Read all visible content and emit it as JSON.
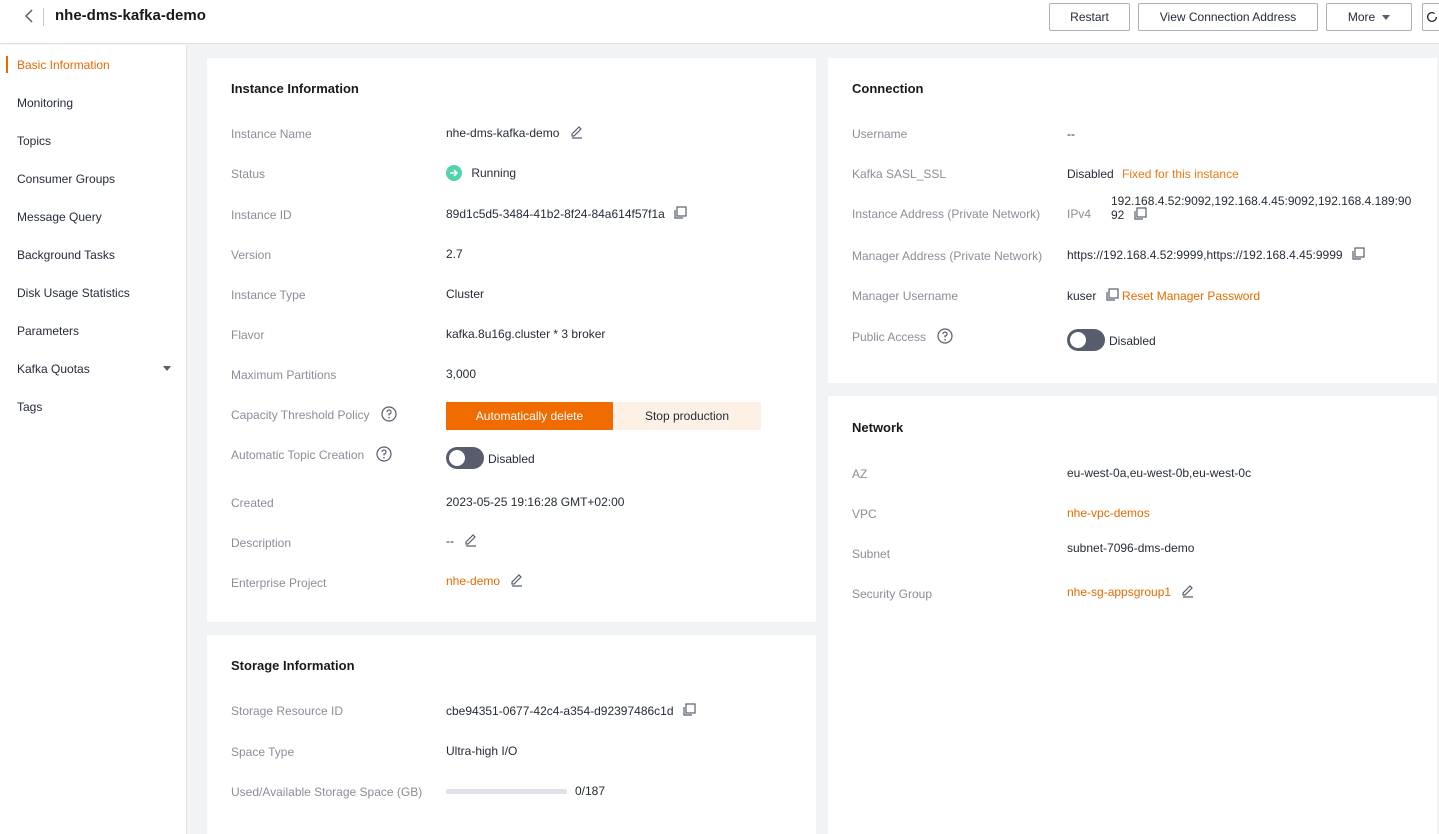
{
  "header": {
    "title": "nhe-dms-kafka-demo",
    "restart_label": "Restart",
    "view_connection_label": "View Connection Address",
    "more_label": "More"
  },
  "sidebar": {
    "items": [
      {
        "label": "Basic Information",
        "active": true
      },
      {
        "label": "Monitoring"
      },
      {
        "label": "Topics"
      },
      {
        "label": "Consumer Groups"
      },
      {
        "label": "Message Query"
      },
      {
        "label": "Background Tasks"
      },
      {
        "label": "Disk Usage Statistics"
      },
      {
        "label": "Parameters"
      },
      {
        "label": "Kafka Quotas",
        "expandable": true
      },
      {
        "label": "Tags"
      }
    ]
  },
  "instance": {
    "title": "Instance Information",
    "name_label": "Instance Name",
    "name_value": "nhe-dms-kafka-demo",
    "status_label": "Status",
    "status_value": "Running",
    "id_label": "Instance ID",
    "id_value": "89d1c5d5-3484-41b2-8f24-84a614f57f1a",
    "version_label": "Version",
    "version_value": "2.7",
    "type_label": "Instance Type",
    "type_value": "Cluster",
    "flavor_label": "Flavor",
    "flavor_value": "kafka.8u16g.cluster * 3 broker",
    "max_partitions_label": "Maximum Partitions",
    "max_partitions_value": "3,000",
    "capacity_label": "Capacity Threshold Policy",
    "capacity_options": [
      "Automatically delete",
      "Stop production"
    ],
    "capacity_selected": "Automatically delete",
    "auto_topic_label": "Automatic Topic Creation",
    "auto_topic_value": "Disabled",
    "created_label": "Created",
    "created_value": "2023-05-25 19:16:28 GMT+02:00",
    "description_label": "Description",
    "description_value": "--",
    "enterprise_label": "Enterprise Project",
    "enterprise_value": "nhe-demo"
  },
  "connection": {
    "title": "Connection",
    "username_label": "Username",
    "username_value": "--",
    "sasl_label": "Kafka SASL_SSL",
    "sasl_value": "Disabled",
    "sasl_note": "Fixed for this instance",
    "instance_addr_label": "Instance Address (Private Network)",
    "instance_addr_proto": "IPv4",
    "instance_addr_line1": "192.168.4.52:9092,192.168.4.45:9092,192.168.4.189:90",
    "instance_addr_line2": "92",
    "manager_addr_label": "Manager Address (Private Network)",
    "manager_addr_value": "https://192.168.4.52:9999,https://192.168.4.45:9999",
    "manager_user_label": "Manager Username",
    "manager_user_value": "kuser",
    "reset_password_label": "Reset Manager Password",
    "public_access_label": "Public Access",
    "public_access_value": "Disabled"
  },
  "network": {
    "title": "Network",
    "az_label": "AZ",
    "az_value": "eu-west-0a,eu-west-0b,eu-west-0c",
    "vpc_label": "VPC",
    "vpc_value": "nhe-vpc-demos",
    "subnet_label": "Subnet",
    "subnet_value": "subnet-7096-dms-demo",
    "sg_label": "Security Group",
    "sg_value": "nhe-sg-appsgroup1"
  },
  "storage": {
    "title": "Storage Information",
    "resource_id_label": "Storage Resource ID",
    "resource_id_value": "cbe94351-0677-42c4-a354-d92397486c1d",
    "space_type_label": "Space Type",
    "space_type_value": "Ultra-high I/O",
    "used_label": "Used/Available Storage Space (GB)",
    "used_value": "0/187",
    "used_fraction": 0
  },
  "colors": {
    "accent": "#e66b00",
    "running": "#50d4ab"
  }
}
